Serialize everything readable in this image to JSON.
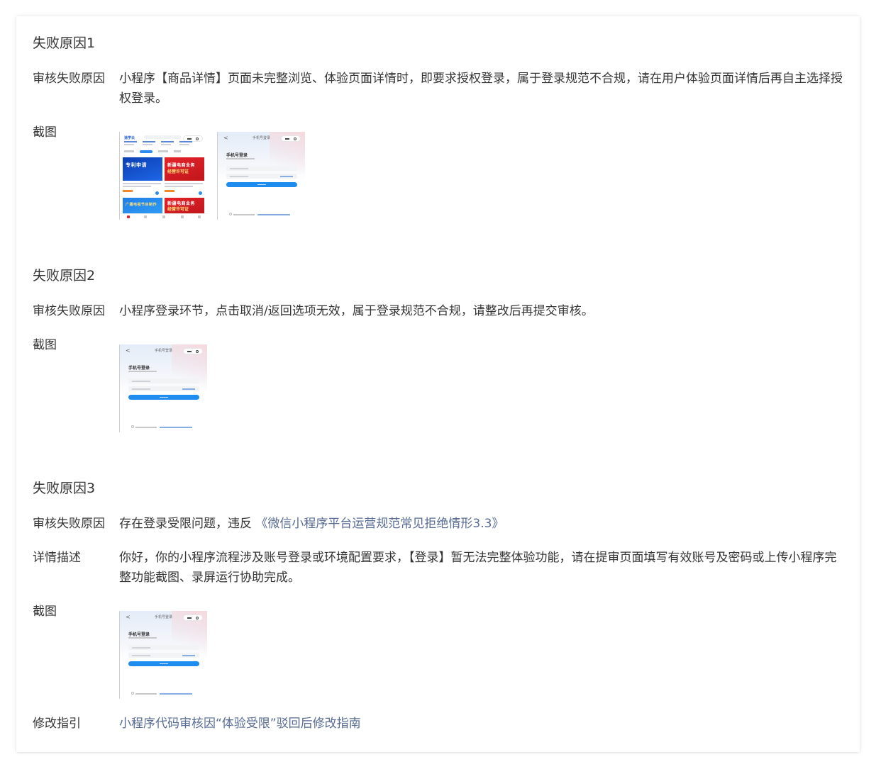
{
  "sections": [
    {
      "title": "失败原因1",
      "rows": [
        {
          "label": "审核失败原因",
          "value": "小程序【商品详情】页面未完整浏览、体验页面详情时，即要求授权登录，属于登录规范不合规，请在用户体验页面详情后再自主选择授权登录。"
        },
        {
          "label": "截图"
        }
      ]
    },
    {
      "title": "失败原因2",
      "rows": [
        {
          "label": "审核失败原因",
          "value": "小程序登录环节，点击取消/返回选项无效，属于登录规范不合规，请整改后再提交审核。"
        },
        {
          "label": "截图"
        }
      ]
    },
    {
      "title": "失败原因3",
      "rows": [
        {
          "label": "审核失败原因",
          "value": "存在登录受限问题，违反",
          "link": "《微信小程序平台运营规范常见拒绝情形3.3》"
        },
        {
          "label": "详情描述",
          "value": "你好，你的小程序流程涉及账号登录或环境配置要求，【登录】暂无法完整体验功能，请在提审页面填写有效账号及密码或上传小程序完整功能截图、录屏运行协助完成。"
        },
        {
          "label": "截图"
        },
        {
          "label": "修改指引",
          "link": "小程序代码审核因“体验受限”驳回后修改指南"
        }
      ]
    }
  ],
  "thumb_home": {
    "logo": "速学云",
    "product_1": {
      "line1": "专利申请",
      "line2": ""
    },
    "product_2": {
      "line1": "新疆电商业务",
      "line2": "经营许可证"
    },
    "product_3": {
      "line1": "广播电视节目制作",
      "line2": ""
    },
    "product_4": {
      "line1": "新疆电商业务",
      "line2": "经营许可证"
    }
  },
  "thumb_login": {
    "back": "<",
    "title": "手机号登录",
    "heading": "手机号登录"
  },
  "colors": {
    "link": "#576b95",
    "text": "#353535",
    "primary_button": "#1f8cf0"
  }
}
